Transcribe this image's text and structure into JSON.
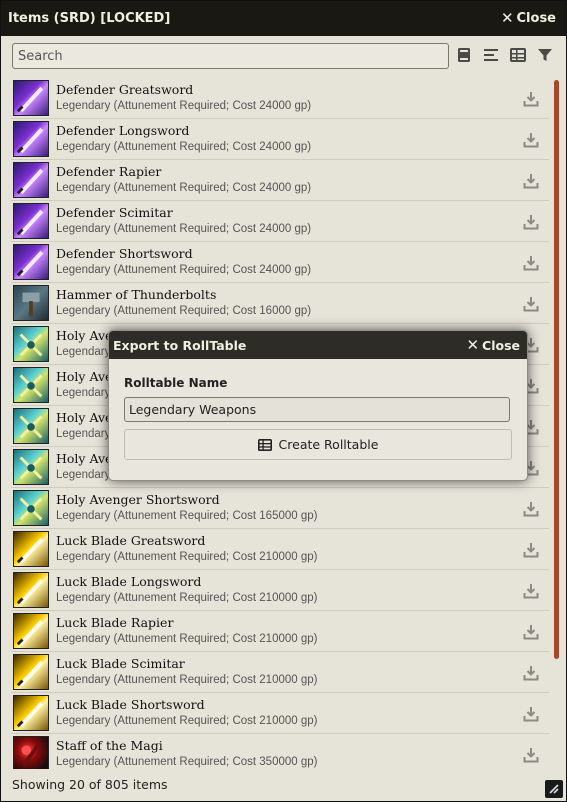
{
  "window": {
    "title": "Items (SRD) [LOCKED]",
    "close_label": "Close"
  },
  "search": {
    "placeholder": "Search",
    "value": ""
  },
  "toolbar_icons": [
    "book-icon",
    "list-icon",
    "table-icon",
    "filter-icon"
  ],
  "items": [
    {
      "name": "Defender Greatsword",
      "detail": "Legendary (Attunement Required; Cost 24000 gp)",
      "thumb": "defender"
    },
    {
      "name": "Defender Longsword",
      "detail": "Legendary (Attunement Required; Cost 24000 gp)",
      "thumb": "defender"
    },
    {
      "name": "Defender Rapier",
      "detail": "Legendary (Attunement Required; Cost 24000 gp)",
      "thumb": "defender"
    },
    {
      "name": "Defender Scimitar",
      "detail": "Legendary (Attunement Required; Cost 24000 gp)",
      "thumb": "defender"
    },
    {
      "name": "Defender Shortsword",
      "detail": "Legendary (Attunement Required; Cost 24000 gp)",
      "thumb": "defender"
    },
    {
      "name": "Hammer of Thunderbolts",
      "detail": "Legendary (Attunement Required; Cost 16000 gp)",
      "thumb": "hammer"
    },
    {
      "name": "Holy Avenger Greatsword",
      "detail": "Legendary (Attunement Required; Cost 165000 gp)",
      "thumb": "holy"
    },
    {
      "name": "Holy Avenger Longsword",
      "detail": "Legendary (Attunement Required; Cost 165000 gp)",
      "thumb": "holy"
    },
    {
      "name": "Holy Avenger Rapier",
      "detail": "Legendary (Attunement Required; Cost 165000 gp)",
      "thumb": "holy"
    },
    {
      "name": "Holy Avenger Scimitar",
      "detail": "Legendary (Attunement Required; Cost 165000 gp)",
      "thumb": "holy"
    },
    {
      "name": "Holy Avenger Shortsword",
      "detail": "Legendary (Attunement Required; Cost 165000 gp)",
      "thumb": "holy"
    },
    {
      "name": "Luck Blade Greatsword",
      "detail": "Legendary (Attunement Required; Cost 210000 gp)",
      "thumb": "luck"
    },
    {
      "name": "Luck Blade Longsword",
      "detail": "Legendary (Attunement Required; Cost 210000 gp)",
      "thumb": "luck"
    },
    {
      "name": "Luck Blade Rapier",
      "detail": "Legendary (Attunement Required; Cost 210000 gp)",
      "thumb": "luck"
    },
    {
      "name": "Luck Blade Scimitar",
      "detail": "Legendary (Attunement Required; Cost 210000 gp)",
      "thumb": "luck"
    },
    {
      "name": "Luck Blade Shortsword",
      "detail": "Legendary (Attunement Required; Cost 210000 gp)",
      "thumb": "luck"
    },
    {
      "name": "Staff of the Magi",
      "detail": "Legendary (Attunement Required; Cost 350000 gp)",
      "thumb": "staff"
    }
  ],
  "footer": {
    "status": "Showing 20 of 805 items"
  },
  "modal": {
    "title": "Export to RollTable",
    "close_label": "Close",
    "field_label": "Rolltable Name",
    "field_value": "Legendary Weapons",
    "button_label": "Create Rolltable"
  },
  "colors": {
    "titlebar": "#191813",
    "panel": "#e6e3d9",
    "scrollbar": "#a34a2a",
    "modal_title": "#2d2c27"
  }
}
